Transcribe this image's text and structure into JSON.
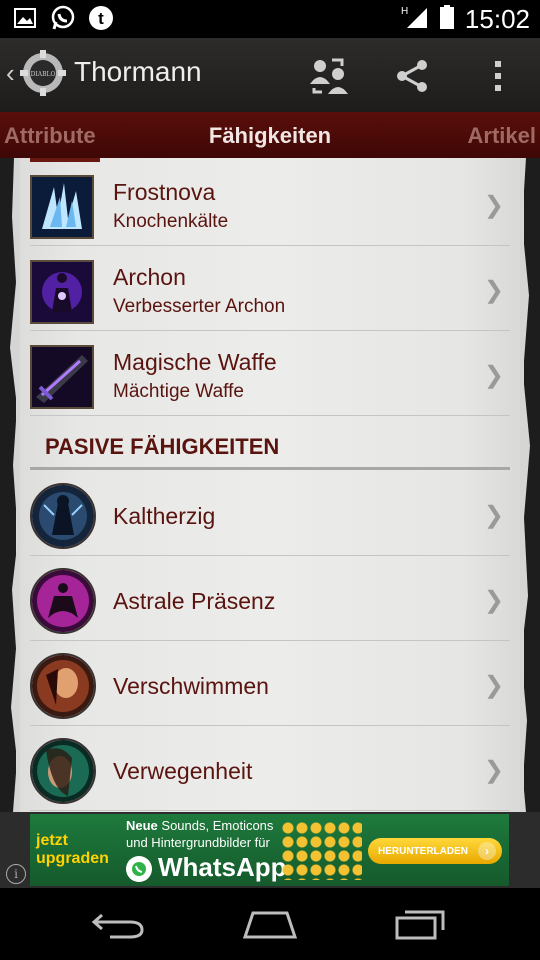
{
  "status_bar": {
    "time": "15:02",
    "left_icons": [
      "image-icon",
      "whatsapp-icon",
      "tumblr-icon"
    ],
    "right_icons": [
      "signal-icon",
      "battery-icon"
    ]
  },
  "action_bar": {
    "title": "Thormann",
    "actions": [
      "switch-users-icon",
      "share-icon",
      "overflow-menu-icon"
    ]
  },
  "tabs": {
    "left": "Attribute",
    "center": "Fähigkeiten",
    "right": "Artikel"
  },
  "active_skills": [
    {
      "title": "Frostnova",
      "rune": "Knochenkälte",
      "icon": "frost-nova-icon"
    },
    {
      "title": "Archon",
      "rune": "Verbesserter Archon",
      "icon": "archon-icon"
    },
    {
      "title": "Magische Waffe",
      "rune": "Mächtige Waffe",
      "icon": "magic-weapon-icon"
    }
  ],
  "passive_header": "PASIVE FÄHIGKEITEN",
  "passive_skills": [
    {
      "title": "Kaltherzig",
      "icon": "cold-blooded-icon"
    },
    {
      "title": "Astrale Präsenz",
      "icon": "astral-presence-icon"
    },
    {
      "title": "Verschwimmen",
      "icon": "blur-icon"
    },
    {
      "title": "Verwegenheit",
      "icon": "audacity-icon"
    }
  ],
  "ad": {
    "cta_left": "jetzt upgraden",
    "line1_bold": "Neue",
    "line1_rest": " Sounds, Emoticons",
    "line2": "und Hintergrundbilder für",
    "brand": "WhatsApp",
    "button": "HERUNTERLADEN",
    "info": "i"
  },
  "colors": {
    "accent_red": "#5a1410",
    "tab_bar": "#4a0a08",
    "paper": "#ebebe9"
  }
}
